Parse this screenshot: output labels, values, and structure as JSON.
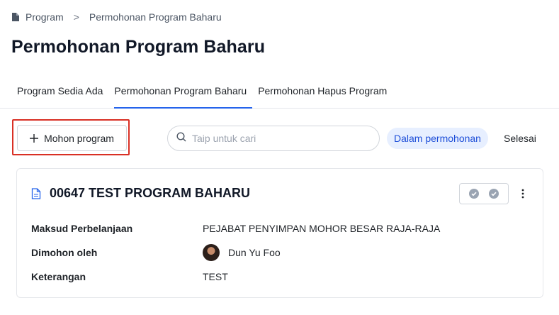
{
  "breadcrumb": {
    "root": "Program",
    "separator": ">",
    "current": "Permohonan Program Baharu"
  },
  "page": {
    "title": "Permohonan Program Baharu"
  },
  "tabs": [
    {
      "label": "Program Sedia Ada",
      "active": false
    },
    {
      "label": "Permohonan Program Baharu",
      "active": true
    },
    {
      "label": "Permohonan Hapus Program",
      "active": false
    }
  ],
  "toolbar": {
    "apply_label": "Mohon program",
    "search_placeholder": "Taip untuk cari",
    "search_value": "",
    "filter_in_progress": "Dalam permohonan",
    "filter_done": "Selesai"
  },
  "card": {
    "title": "00647 TEST PROGRAM BAHARU",
    "fields": [
      {
        "label": "Maksud Perbelanjaan",
        "value": "PEJABAT PENYIMPAN MOHOR BESAR RAJA-RAJA"
      },
      {
        "label": "Dimohon oleh",
        "value": "Dun Yu Foo"
      },
      {
        "label": "Keterangan",
        "value": "TEST"
      }
    ]
  },
  "colors": {
    "accent": "#2563eb",
    "highlight_border": "#d93025",
    "chip_bg": "#e7efff",
    "check_icon": "#9aa4b2"
  },
  "icons": {
    "breadcrumb": "document-icon",
    "apply": "plus-icon",
    "search": "search-icon",
    "card": "file-icon",
    "status": "check-circle-icon",
    "menu": "more-vertical-icon"
  }
}
